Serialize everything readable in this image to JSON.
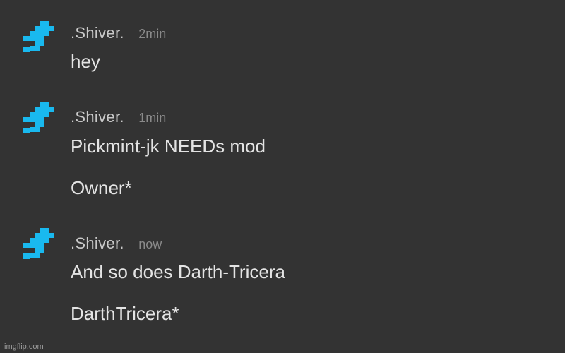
{
  "messages": [
    {
      "username": ".Shiver.",
      "time": "2min",
      "lines": [
        "hey"
      ]
    },
    {
      "username": ".Shiver.",
      "time": "1min",
      "lines": [
        "Pickmint-jk NEEDs mod",
        "Owner*"
      ]
    },
    {
      "username": ".Shiver.",
      "time": "now",
      "lines": [
        "And so does Darth-Tricera",
        "DarthTricera*"
      ]
    }
  ],
  "avatar_icon": "blue-pixel-arrow-icon",
  "avatar_color": "#19b9ef",
  "watermark": "imgflip.com"
}
